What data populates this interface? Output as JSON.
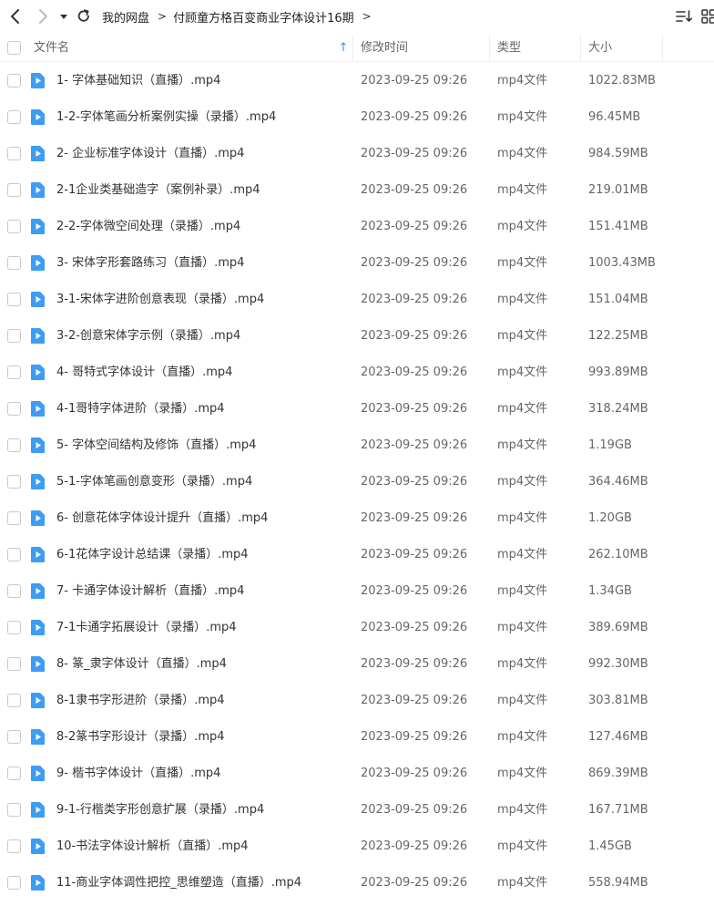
{
  "breadcrumb": {
    "items": [
      "我的网盘",
      "付顾童方格百变商业字体设计16期"
    ],
    "separator": ">"
  },
  "icons": {
    "back": "chevron-left-icon",
    "forward": "chevron-right-icon",
    "history": "caret-down-icon",
    "refresh": "refresh-icon",
    "sort": "sort-list-icon",
    "view": "grid-view-icon",
    "file": "video-file-icon"
  },
  "colors": {
    "file_icon": "#3d9cf5",
    "sort_arrow": "#2f8ff5"
  },
  "columns": {
    "name": "文件名",
    "modified": "修改时间",
    "type": "类型",
    "size": "大小",
    "sort_indicator": "↑"
  },
  "files": [
    {
      "name": "1- 字体基础知识（直播）.mp4",
      "modified": "2023-09-25 09:26",
      "type": "mp4文件",
      "size": "1022.83MB"
    },
    {
      "name": "1-2-字体笔画分析案例实操（录播）.mp4",
      "modified": "2023-09-25 09:26",
      "type": "mp4文件",
      "size": "96.45MB"
    },
    {
      "name": "2- 企业标准字体设计（直播）.mp4",
      "modified": "2023-09-25 09:26",
      "type": "mp4文件",
      "size": "984.59MB"
    },
    {
      "name": "2-1企业类基础造字（案例补录）.mp4",
      "modified": "2023-09-25 09:26",
      "type": "mp4文件",
      "size": "219.01MB"
    },
    {
      "name": "2-2-字体微空间处理（录播）.mp4",
      "modified": "2023-09-25 09:26",
      "type": "mp4文件",
      "size": "151.41MB"
    },
    {
      "name": "3- 宋体字形套路练习（直播）.mp4",
      "modified": "2023-09-25 09:26",
      "type": "mp4文件",
      "size": "1003.43MB"
    },
    {
      "name": "3-1-宋体字进阶创意表现（录播）.mp4",
      "modified": "2023-09-25 09:26",
      "type": "mp4文件",
      "size": "151.04MB"
    },
    {
      "name": "3-2-创意宋体字示例（录播）.mp4",
      "modified": "2023-09-25 09:26",
      "type": "mp4文件",
      "size": "122.25MB"
    },
    {
      "name": "4- 哥特式字体设计（直播）.mp4",
      "modified": "2023-09-25 09:26",
      "type": "mp4文件",
      "size": "993.89MB"
    },
    {
      "name": "4-1哥特字体进阶（录播）.mp4",
      "modified": "2023-09-25 09:26",
      "type": "mp4文件",
      "size": "318.24MB"
    },
    {
      "name": "5- 字体空间结构及修饰（直播）.mp4",
      "modified": "2023-09-25 09:26",
      "type": "mp4文件",
      "size": "1.19GB"
    },
    {
      "name": "5-1-字体笔画创意变形（录播）.mp4",
      "modified": "2023-09-25 09:26",
      "type": "mp4文件",
      "size": "364.46MB"
    },
    {
      "name": "6- 创意花体字体设计提升（直播）.mp4",
      "modified": "2023-09-25 09:26",
      "type": "mp4文件",
      "size": "1.20GB"
    },
    {
      "name": "6-1花体字设计总结课（录播）.mp4",
      "modified": "2023-09-25 09:26",
      "type": "mp4文件",
      "size": "262.10MB"
    },
    {
      "name": "7- 卡通字体设计解析（直播）.mp4",
      "modified": "2023-09-25 09:26",
      "type": "mp4文件",
      "size": "1.34GB"
    },
    {
      "name": "7-1卡通字拓展设计（录播）.mp4",
      "modified": "2023-09-25 09:26",
      "type": "mp4文件",
      "size": "389.69MB"
    },
    {
      "name": "8- 篆_隶字体设计（直播）.mp4",
      "modified": "2023-09-25 09:26",
      "type": "mp4文件",
      "size": "992.30MB"
    },
    {
      "name": "8-1隶书字形进阶（录播）.mp4",
      "modified": "2023-09-25 09:26",
      "type": "mp4文件",
      "size": "303.81MB"
    },
    {
      "name": "8-2篆书字形设计（录播）.mp4",
      "modified": "2023-09-25 09:26",
      "type": "mp4文件",
      "size": "127.46MB"
    },
    {
      "name": "9- 楷书字体设计（直播）.mp4",
      "modified": "2023-09-25 09:26",
      "type": "mp4文件",
      "size": "869.39MB"
    },
    {
      "name": "9-1-行楷类字形创意扩展（录播）.mp4",
      "modified": "2023-09-25 09:26",
      "type": "mp4文件",
      "size": "167.71MB"
    },
    {
      "name": "10-书法字体设计解析（直播）.mp4",
      "modified": "2023-09-25 09:26",
      "type": "mp4文件",
      "size": "1.45GB"
    },
    {
      "name": "11-商业字体调性把控_思维塑造（直播）.mp4",
      "modified": "2023-09-25 09:26",
      "type": "mp4文件",
      "size": "558.94MB"
    }
  ]
}
